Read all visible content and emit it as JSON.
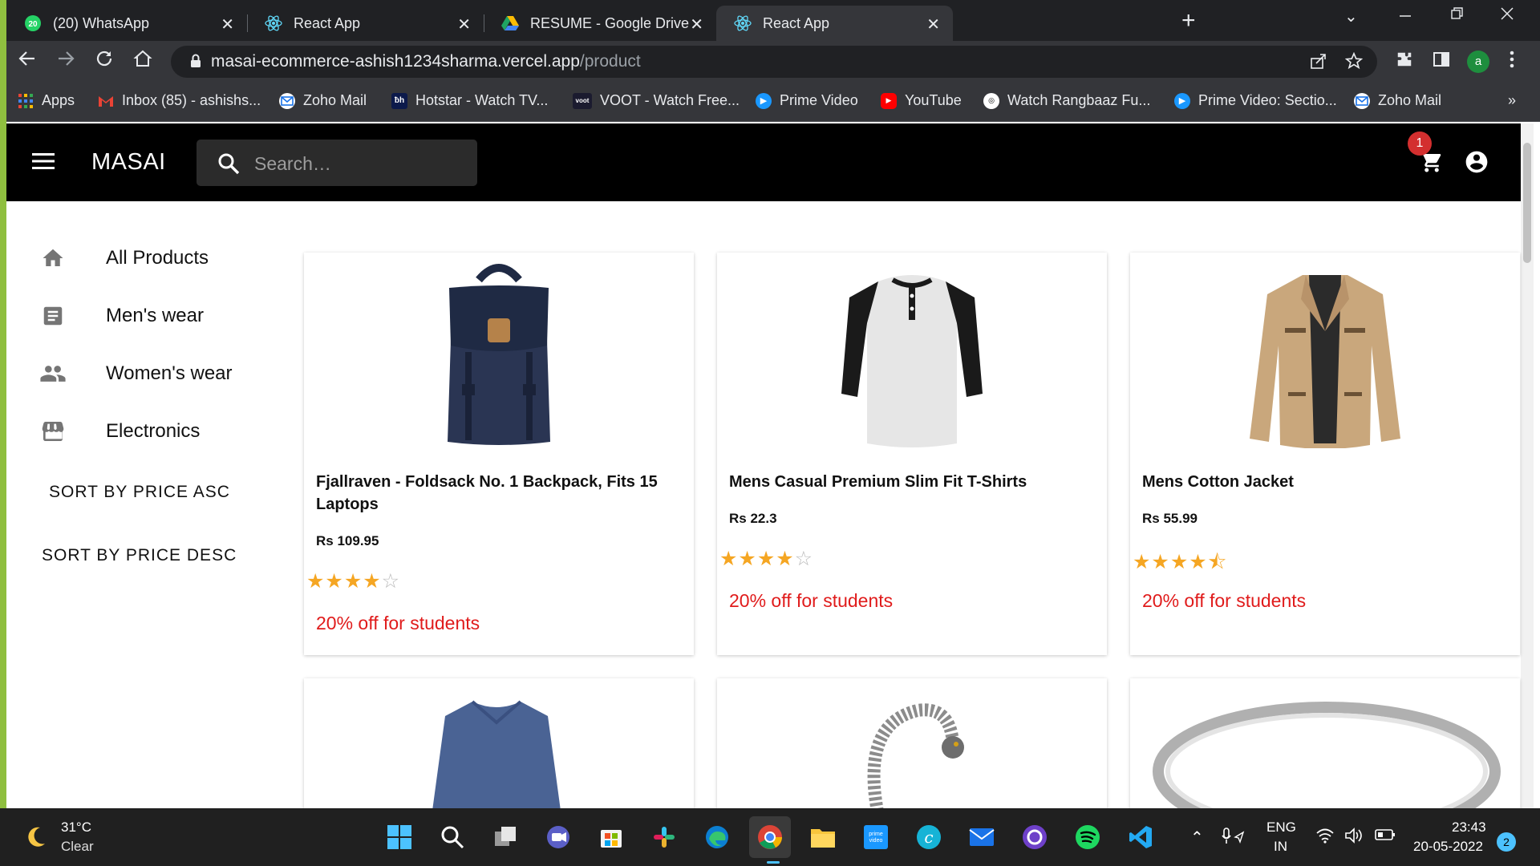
{
  "browser": {
    "tabs": [
      {
        "title": "(20) WhatsApp",
        "badge": "20",
        "icon": "whatsapp-icon"
      },
      {
        "title": "React App",
        "icon": "react-icon"
      },
      {
        "title": "RESUME - Google Drive",
        "icon": "google-drive-icon"
      },
      {
        "title": "React App",
        "icon": "react-icon"
      }
    ],
    "active_tab": 3,
    "url_host": "masai-ecommerce-ashish1234sharma.vercel.app",
    "url_path": "/product",
    "profile_initial": "a",
    "bookmarks": [
      {
        "label": "Apps",
        "icon": "apps-grid-icon"
      },
      {
        "label": "Inbox (85) - ashishs...",
        "icon": "gmail-icon"
      },
      {
        "label": "Zoho Mail",
        "icon": "zoho-mail-icon"
      },
      {
        "label": "Hotstar - Watch TV...",
        "icon": "hotstar-icon"
      },
      {
        "label": "VOOT - Watch Free...",
        "icon": "voot-icon"
      },
      {
        "label": "Prime Video",
        "icon": "prime-video-icon"
      },
      {
        "label": "YouTube",
        "icon": "youtube-icon"
      },
      {
        "label": "Watch Rangbaaz Fu...",
        "icon": "zee5-icon"
      },
      {
        "label": "Prime Video: Sectio...",
        "icon": "prime-video-icon"
      },
      {
        "label": "Zoho Mail",
        "icon": "zoho-mail-icon"
      }
    ],
    "bookmarks_overflow": "»"
  },
  "app": {
    "brand": "MASAI",
    "search_placeholder": "Search…",
    "cart_count": "1",
    "sidebar": [
      {
        "label": "All Products",
        "icon": "home-icon"
      },
      {
        "label": "Men's wear",
        "icon": "article-icon"
      },
      {
        "label": "Women's wear",
        "icon": "people-icon"
      },
      {
        "label": "Electronics",
        "icon": "store-icon"
      }
    ],
    "sort_asc": "SORT BY PRICE ASC",
    "sort_desc": "SORT BY PRICE DESC",
    "products": [
      {
        "title": "Fjallraven - Foldsack No. 1 Backpack, Fits 15 Laptops",
        "price": "Rs 109.95",
        "rating": 4,
        "promo": "20% off for students",
        "image": "backpack"
      },
      {
        "title": "Mens Casual Premium Slim Fit T-Shirts",
        "price": "Rs 22.3",
        "rating": 4,
        "promo": "20% off for students",
        "image": "henley-tshirt"
      },
      {
        "title": "Mens Cotton Jacket",
        "price": "Rs 55.99",
        "rating": 4.5,
        "promo": "20% off for students",
        "image": "cotton-jacket"
      }
    ],
    "products_row2_images": [
      "blue-sweater",
      "dragon-bracelet",
      "silver-ring"
    ]
  },
  "taskbar": {
    "temperature": "31°C",
    "condition": "Clear",
    "lang_line1": "ENG",
    "lang_line2": "IN",
    "time": "23:43",
    "date": "20-05-2022",
    "notifications": "2"
  },
  "colors": {
    "accent_promo": "#e01b1b",
    "star": "#f5a623",
    "appbar": "#000000",
    "badge": "#d32f2f"
  }
}
